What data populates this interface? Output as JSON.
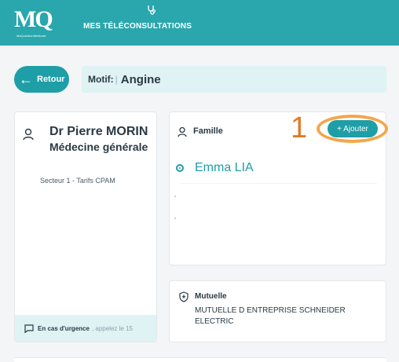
{
  "header": {
    "logo_text": "MQ",
    "logo_subtitle": "MaQuestionMedicale",
    "nav_title": "MES TÉLÉCONSULTATIONS",
    "nav_icon": "stethoscope-icon",
    "background_color": "#2AA6AD"
  },
  "toolbar": {
    "back_label": "Retour",
    "motif_label": "Motif:",
    "motif_value": "Angine"
  },
  "doctor": {
    "name": "Dr Pierre MORIN",
    "specialty": "Médecine générale",
    "sector": "Secteur 1 - Tarifs CPAM",
    "urgence_bold": "En cas d'urgence",
    "urgence_rest": ", appelez le 15"
  },
  "famille": {
    "label": "Famille",
    "add_label": "+ Ajouter",
    "members": [
      {
        "name": "Emma LIA",
        "selected": true
      }
    ]
  },
  "annotation": {
    "step_number": "1",
    "ring_color": "#F5A54A",
    "number_color": "#E07B22"
  },
  "mutuelle": {
    "label": "Mutuelle",
    "value": "MUTUELLE D ENTREPRISE SCHNEIDER ELECTRIC"
  },
  "colors": {
    "accent": "#1E9EA6",
    "light_accent_bg": "#dff2f4",
    "page_bg": "#f3f5f6"
  }
}
